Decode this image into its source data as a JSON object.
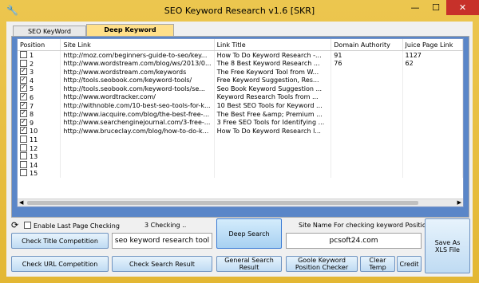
{
  "window": {
    "title": "SEO Keyword Research v1.6 [SKR]",
    "min_glyph": "—",
    "max_glyph": "☐",
    "close_glyph": "✕"
  },
  "tabs": [
    {
      "label": "SEO KeyWord Research",
      "active": false
    },
    {
      "label": "Deep Keyword Research",
      "active": true
    }
  ],
  "table": {
    "columns": [
      "Position",
      "Site Link",
      "Link Title",
      "Domain Authority",
      "Juice Page Link"
    ],
    "rows": [
      {
        "pos": "1",
        "checked": false,
        "link": "http://moz.com/beginners-guide-to-seo/key...",
        "title": "How To Do Keyword Research -...",
        "da": "91",
        "juice": "1127"
      },
      {
        "pos": "2",
        "checked": false,
        "link": "http://www.wordstream.com/blog/ws/2013/0...",
        "title": "The 8 Best Keyword Research ...",
        "da": "76",
        "juice": "62"
      },
      {
        "pos": "3",
        "checked": true,
        "link": "http://www.wordstream.com/keywords",
        "title": "The Free Keyword Tool from W...",
        "da": "",
        "juice": ""
      },
      {
        "pos": "4",
        "checked": true,
        "link": "http://tools.seobook.com/keyword-tools/",
        "title": "Free Keyword Suggestion, Res...",
        "da": "",
        "juice": ""
      },
      {
        "pos": "5",
        "checked": true,
        "link": "http://tools.seobook.com/keyword-tools/se...",
        "title": "Seo Book Keyword Suggestion ...",
        "da": "",
        "juice": ""
      },
      {
        "pos": "6",
        "checked": true,
        "link": "http://www.wordtracker.com/",
        "title": "Keyword Research Tools from ...",
        "da": "",
        "juice": ""
      },
      {
        "pos": "7",
        "checked": true,
        "link": "http://withnoble.com/10-best-seo-tools-for-k...",
        "title": "10 Best SEO Tools for Keyword ...",
        "da": "",
        "juice": ""
      },
      {
        "pos": "8",
        "checked": true,
        "link": "http://www.iacquire.com/blog/the-best-free-...",
        "title": "The Best Free &amp; Premium ...",
        "da": "",
        "juice": ""
      },
      {
        "pos": "9",
        "checked": true,
        "link": "http://www.searchenginejournal.com/3-free-...",
        "title": "3 Free SEO Tools for Identifying ...",
        "da": "",
        "juice": ""
      },
      {
        "pos": "10",
        "checked": true,
        "link": "http://www.bruceclay.com/blog/how-to-do-k...",
        "title": "How To Do Keyword Research l...",
        "da": "",
        "juice": ""
      },
      {
        "pos": "11",
        "checked": false,
        "link": "",
        "title": "",
        "da": "",
        "juice": ""
      },
      {
        "pos": "12",
        "checked": false,
        "link": "",
        "title": "",
        "da": "",
        "juice": ""
      },
      {
        "pos": "13",
        "checked": false,
        "link": "",
        "title": "",
        "da": "",
        "juice": ""
      },
      {
        "pos": "14",
        "checked": false,
        "link": "",
        "title": "",
        "da": "",
        "juice": ""
      },
      {
        "pos": "15",
        "checked": false,
        "link": "",
        "title": "",
        "da": "",
        "juice": ""
      }
    ]
  },
  "controls": {
    "enable_last_page_label": "Enable Last Page Checking",
    "enable_last_page_checked": false,
    "checking_status": "3 Checking ..",
    "check_title_btn": "Check Title Competition",
    "keyword_value": "seo keyword research tool",
    "deep_search_btn": "Deep Search",
    "site_name_label": "Site Name For checking keyword Position",
    "site_value": "pcsoft24.com",
    "save_xls_btn": "Save As XLS File",
    "check_url_btn": "Check URL Competition",
    "check_search_btn": "Check Search Result",
    "general_search_btn": "General Search Result",
    "goole_checker_btn": "Goole Keyword Position Checker",
    "clear_temp_btn": "Clear Temp",
    "credit_btn": "Credit"
  }
}
